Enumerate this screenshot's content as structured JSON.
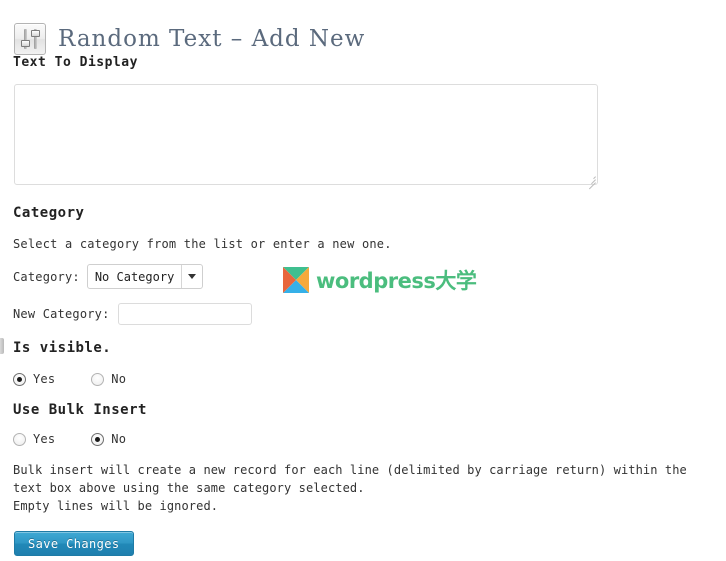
{
  "header": {
    "icon": "sliders-icon",
    "title": "Random Text – Add New"
  },
  "sections": {
    "text_to_display": {
      "heading": "Text To Display",
      "textarea_value": "",
      "textarea_placeholder": ""
    },
    "category": {
      "heading": "Category",
      "help_text": "Select a category from the list or enter a new one.",
      "select_label": "Category:",
      "select_value": "No Category",
      "select_options": [
        "No Category"
      ],
      "new_label": "New Category:",
      "new_value": "",
      "new_placeholder": ""
    },
    "is_visible": {
      "heading": "Is visible.",
      "options": [
        {
          "label": "Yes",
          "checked": true
        },
        {
          "label": "No",
          "checked": false
        }
      ]
    },
    "bulk_insert": {
      "heading": "Use Bulk Insert",
      "options": [
        {
          "label": "Yes",
          "checked": false
        },
        {
          "label": "No",
          "checked": true
        }
      ],
      "description_line1": "Bulk insert will create a new record for each line (delimited by carriage return) within the text box above using the same category selected.",
      "description_line2": "Empty lines will be ignored."
    }
  },
  "footer": {
    "save_label": "Save Changes"
  },
  "watermark": {
    "mark": "wordpress-daxue-logo",
    "text": "wordpress大学",
    "colors": {
      "text_green": "#4bbd7e",
      "mark_top": "#3fbf8f",
      "mark_right": "#f5a93c",
      "mark_bottom": "#35b0e8",
      "mark_left": "#e8663c"
    }
  },
  "colors": {
    "page_background": "#ffffff",
    "title": "#5b6a7d",
    "body_text": "#333333",
    "button_accent": "#2189b8",
    "border": "#dddddd"
  }
}
